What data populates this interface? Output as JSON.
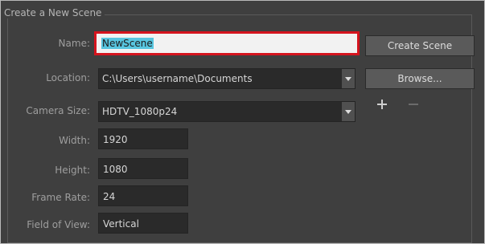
{
  "panel": {
    "title": "Create a New Scene"
  },
  "labels": {
    "name": "Name:",
    "location": "Location:",
    "camera_size": "Camera Size:",
    "width": "Width:",
    "height": "Height:",
    "frame_rate": "Frame Rate:",
    "field_of_view": "Field of View:"
  },
  "values": {
    "name": "NewScene",
    "location": "C:\\Users\\username\\Documents",
    "camera_size": "HDTV_1080p24",
    "width": "1920",
    "height": "1080",
    "frame_rate": "24",
    "field_of_view": "Vertical"
  },
  "buttons": {
    "create_scene": "Create Scene",
    "browse": "Browse..."
  },
  "icons": {
    "add": "plus-icon",
    "remove": "minus-icon",
    "dropdown": "chevron-down-icon"
  },
  "colors": {
    "highlight_border": "#d4141e",
    "selection": "#58c6e0",
    "panel_bg": "#3f3f3f"
  }
}
